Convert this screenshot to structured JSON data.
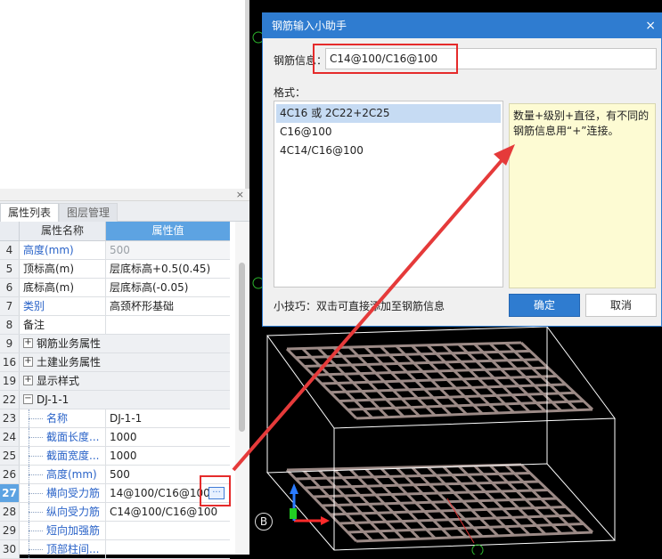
{
  "panel": {
    "close_icon": "×",
    "tabs": [
      {
        "label": "属性列表",
        "active": true
      },
      {
        "label": "图层管理",
        "active": false
      }
    ],
    "columns": {
      "name": "属性名称",
      "value": "属性值"
    }
  },
  "rows": [
    {
      "num": "4",
      "name": "高度(mm)",
      "value": "500"
    },
    {
      "num": "5",
      "name": "顶标高(m)",
      "value": "层底标高+0.5(0.45)"
    },
    {
      "num": "6",
      "name": "底标高(m)",
      "value": "层底标高(-0.05)"
    },
    {
      "num": "7",
      "name": "类别",
      "value": "高颈杯形基础"
    },
    {
      "num": "8",
      "name": "备注",
      "value": ""
    },
    {
      "num": "9",
      "expander": "+",
      "name": "钢筋业务属性"
    },
    {
      "num": "16",
      "expander": "+",
      "name": "土建业务属性"
    },
    {
      "num": "19",
      "expander": "+",
      "name": "显示样式"
    },
    {
      "num": "22",
      "expander": "−",
      "name": "DJ-1-1"
    },
    {
      "num": "23",
      "name": "名称",
      "value": "DJ-1-1"
    },
    {
      "num": "24",
      "name": "截面长度...",
      "value": "1000"
    },
    {
      "num": "25",
      "name": "截面宽度...",
      "value": "1000"
    },
    {
      "num": "26",
      "name": "高度(mm)",
      "value": "500"
    },
    {
      "num": "27",
      "name": "横向受力筋",
      "value": "14@100/C16@100"
    },
    {
      "num": "28",
      "name": "纵向受力筋",
      "value": "C14@100/C16@100"
    },
    {
      "num": "29",
      "name": "短向加强筋",
      "value": ""
    },
    {
      "num": "30",
      "name": "顶部柱间...",
      "value": ""
    }
  ],
  "ellipsis_label": "···",
  "dialog": {
    "title": "钢筋输入小助手",
    "close_icon": "×",
    "info_label": "钢筋信息：",
    "info_value": "C14@100/C16@100",
    "format_label": "格式：",
    "formats": [
      "4C16 或 2C22+2C25",
      "C16@100",
      "4C14/C16@100"
    ],
    "description": "数量+级别+直径，有不同的钢筋信息用“+”连接。",
    "tip": "小技巧：双击可直接添加至钢筋信息",
    "ok_label": "确定",
    "cancel_label": "取消"
  },
  "viewport": {
    "axis_label": "B"
  },
  "colors": {
    "accent": "#2f7cd0",
    "highlight_box": "#e52b2b",
    "selected_header": "#5da3e2",
    "rebar": "#9c8a86"
  }
}
